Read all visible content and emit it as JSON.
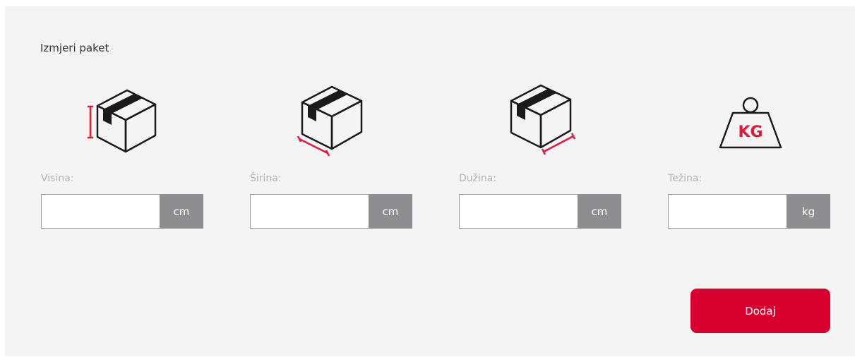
{
  "section_title": "Izmjeri paket",
  "fields": [
    {
      "label": "Visina:",
      "unit": "cm",
      "value": "",
      "icon": "box-height-icon"
    },
    {
      "label": "Širina:",
      "unit": "cm",
      "value": "",
      "icon": "box-width-icon"
    },
    {
      "label": "Dužina:",
      "unit": "cm",
      "value": "",
      "icon": "box-length-icon"
    },
    {
      "label": "Težina:",
      "unit": "kg",
      "value": "",
      "icon": "weight-icon"
    }
  ],
  "weight_icon_text": "KG",
  "add_button_label": "Dodaj",
  "colors": {
    "accent": "#d8002f",
    "unit_bg": "#8e8e90",
    "panel_bg": "#f4f4f4",
    "label_text": "#b3b3b3"
  }
}
